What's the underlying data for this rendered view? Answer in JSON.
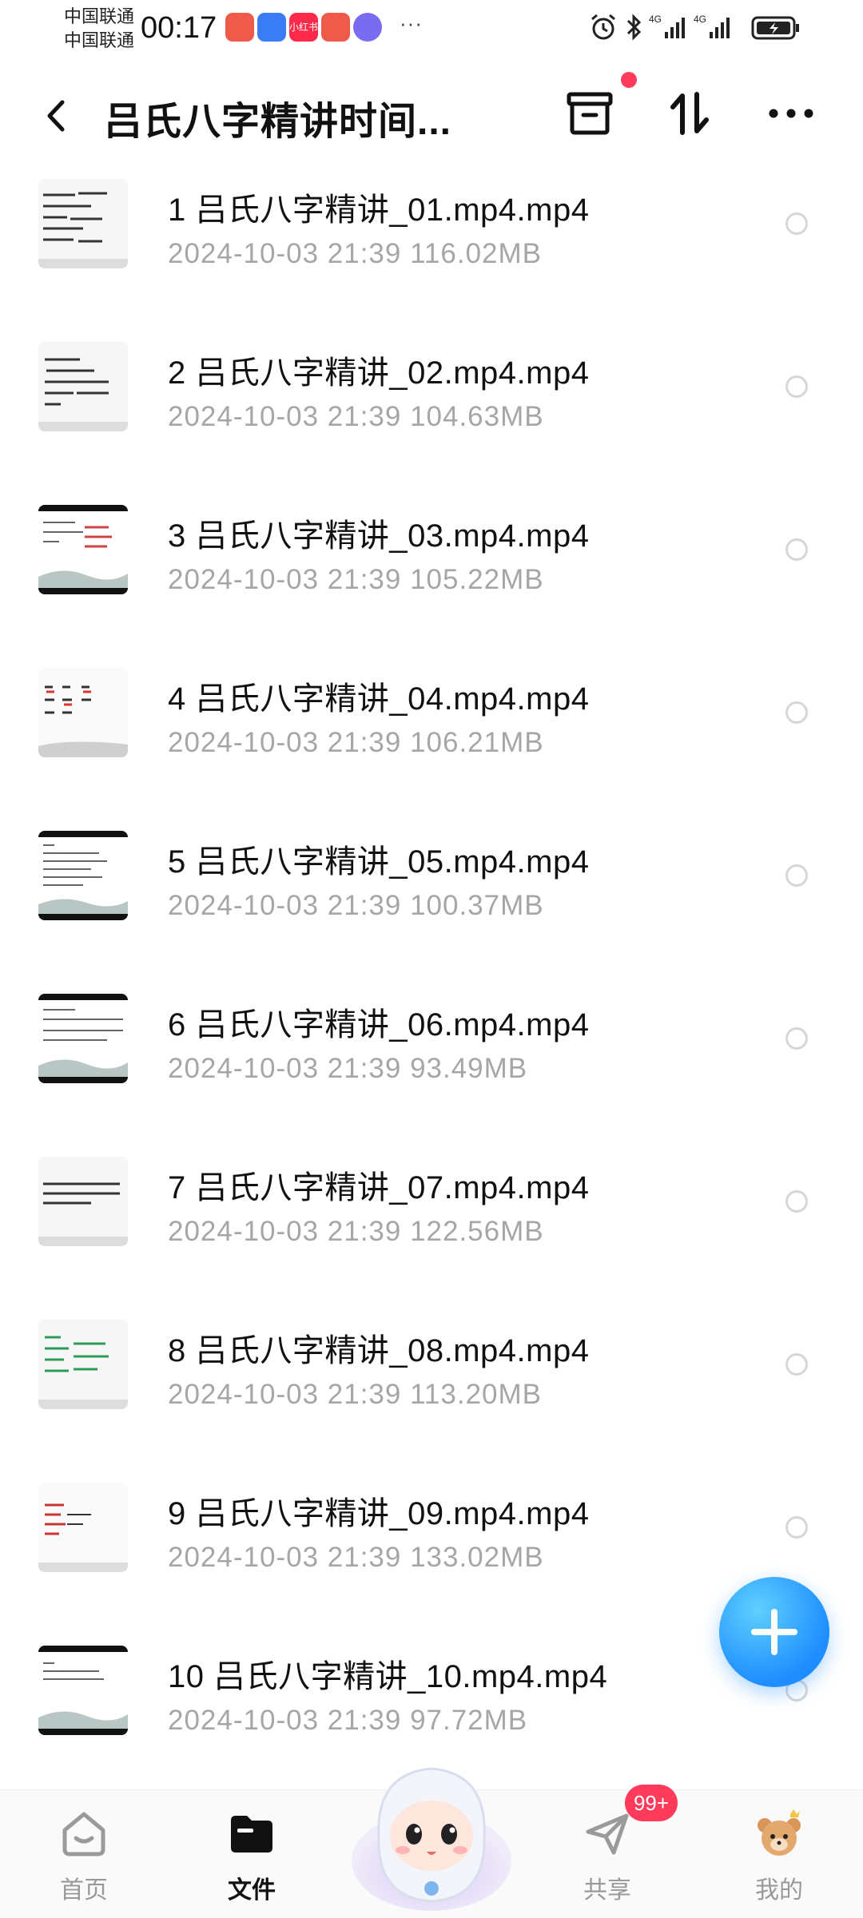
{
  "status_bar": {
    "carrier_1": "中国联通",
    "carrier_2": "中国联通",
    "time": "00:17",
    "notification_apps": [
      "",
      "",
      "小红书",
      "",
      ""
    ],
    "network_1": "4G",
    "network_2": "4G"
  },
  "header": {
    "title": "吕氏八字精讲时间..."
  },
  "files": [
    {
      "name": "1 吕氏八字精讲_01.mp4.mp4",
      "meta": "2024-10-03  21:39  116.02MB"
    },
    {
      "name": "2 吕氏八字精讲_02.mp4.mp4",
      "meta": "2024-10-03  21:39  104.63MB"
    },
    {
      "name": "3 吕氏八字精讲_03.mp4.mp4",
      "meta": "2024-10-03  21:39  105.22MB"
    },
    {
      "name": "4 吕氏八字精讲_04.mp4.mp4",
      "meta": "2024-10-03  21:39  106.21MB"
    },
    {
      "name": "5 吕氏八字精讲_05.mp4.mp4",
      "meta": "2024-10-03  21:39  100.37MB"
    },
    {
      "name": "6 吕氏八字精讲_06.mp4.mp4",
      "meta": "2024-10-03  21:39  93.49MB"
    },
    {
      "name": "7 吕氏八字精讲_07.mp4.mp4",
      "meta": "2024-10-03  21:39  122.56MB"
    },
    {
      "name": "8 吕氏八字精讲_08.mp4.mp4",
      "meta": "2024-10-03  21:39  113.20MB"
    },
    {
      "name": "9 吕氏八字精讲_09.mp4.mp4",
      "meta": "2024-10-03  21:39  133.02MB"
    },
    {
      "name": "10 吕氏八字精讲_10.mp4.mp4",
      "meta": "2024-10-03  21:39  97.72MB"
    }
  ],
  "bottom_nav": {
    "home": "首页",
    "files": "文件",
    "share": "共享",
    "share_badge": "99+",
    "me": "我的"
  },
  "colors": {
    "accent_blue": "#1e8dff",
    "badge_red": "#ff3b5c",
    "meta_gray": "#a6a6a6"
  },
  "icons": [
    "back-icon",
    "recycle-bin-icon",
    "sort-icon",
    "more-icon",
    "add-icon",
    "home-icon",
    "folder-icon",
    "share-icon",
    "profile-avatar-icon"
  ]
}
